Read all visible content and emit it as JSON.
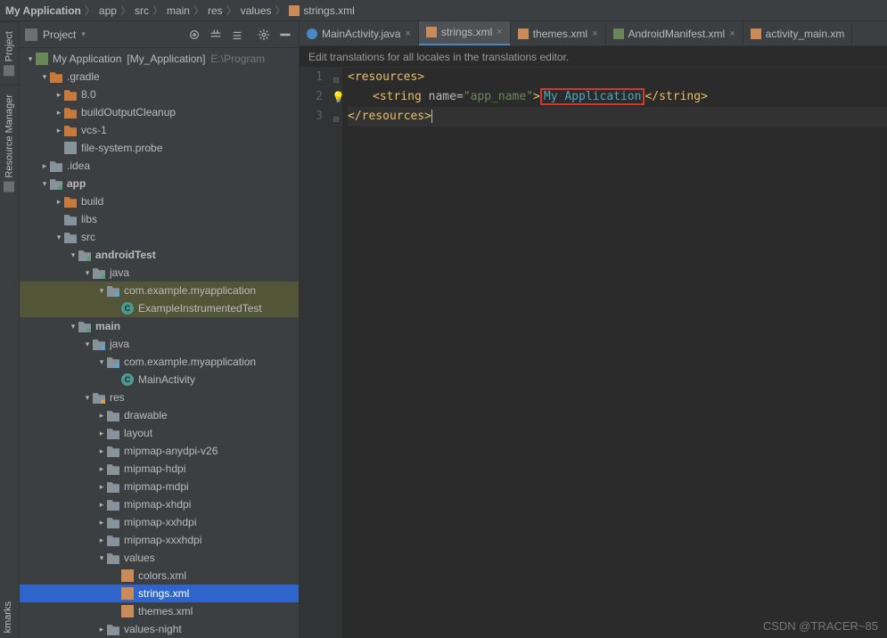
{
  "breadcrumb": {
    "root": "My Application",
    "seg1": "app",
    "seg2": "src",
    "seg3": "main",
    "seg4": "res",
    "seg5": "values",
    "file": "strings.xml"
  },
  "projectPanel": {
    "title": "Project"
  },
  "sideTabs": {
    "project": "Project",
    "resmgr": "Resource Manager",
    "bkmk": "kmarks"
  },
  "tree": {
    "root": "My Application",
    "root_label": "[My_Application]",
    "root_path": "E:\\Program",
    "gradle": ".gradle",
    "gradle_80": "8.0",
    "gradle_boc": "buildOutputCleanup",
    "gradle_vcs": "vcs-1",
    "gradle_probe": "file-system.probe",
    "idea": ".idea",
    "app": "app",
    "build": "build",
    "libs": "libs",
    "src": "src",
    "androidTest": "androidTest",
    "at_java": "java",
    "at_pkg": "com.example.myapplication",
    "at_cls": "ExampleInstrumentedTest",
    "main": "main",
    "m_java": "java",
    "m_pkg": "com.example.myapplication",
    "m_cls": "MainActivity",
    "res": "res",
    "drawable": "drawable",
    "layout": "layout",
    "mip_any": "mipmap-anydpi-v26",
    "mip_h": "mipmap-hdpi",
    "mip_m": "mipmap-mdpi",
    "mip_xh": "mipmap-xhdpi",
    "mip_xxh": "mipmap-xxhdpi",
    "mip_xxxh": "mipmap-xxxhdpi",
    "values": "values",
    "colors": "colors.xml",
    "strings": "strings.xml",
    "themes": "themes.xml",
    "values_night": "values-night"
  },
  "editorTabs": [
    {
      "name": "MainActivity.java",
      "type": "java",
      "active": false
    },
    {
      "name": "strings.xml",
      "type": "xml",
      "active": true
    },
    {
      "name": "themes.xml",
      "type": "xml",
      "active": false
    },
    {
      "name": "AndroidManifest.xml",
      "type": "manifest",
      "active": false
    },
    {
      "name": "activity_main.xm",
      "type": "xml",
      "active": false
    }
  ],
  "infoBar": "Edit translations for all locales in the translations editor.",
  "code": {
    "l1_open_tag": "<resources>",
    "l2_tag_open": "<string",
    "l2_attr": "name",
    "l2_eq": "=",
    "l2_val": "\"app_name\"",
    "l2_gt": ">",
    "l2_text": "My Application",
    "l2_close": "</string>",
    "l3_close": "</resources>",
    "lines": [
      "1",
      "2",
      "3"
    ]
  },
  "watermark": "CSDN @TRACER~85"
}
